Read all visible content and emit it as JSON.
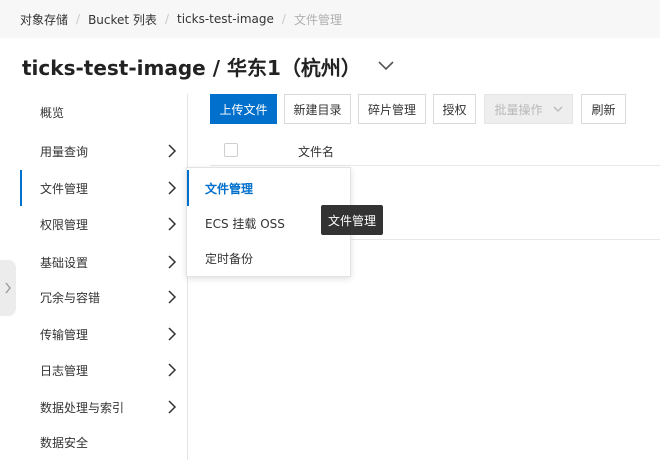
{
  "breadcrumb": {
    "items": [
      "对象存储",
      "Bucket 列表",
      "ticks-test-image",
      "文件管理"
    ],
    "separator": "/"
  },
  "header": {
    "title": "ticks-test-image / 华东1（杭州）",
    "dropdown_icon": "chevron-down-icon"
  },
  "sidebar": {
    "items": [
      {
        "label": "概览",
        "has_arrow": false
      },
      {
        "label": "用量查询",
        "has_arrow": true
      },
      {
        "label": "文件管理",
        "has_arrow": true,
        "active": true
      },
      {
        "label": "权限管理",
        "has_arrow": true
      },
      {
        "label": "基础设置",
        "has_arrow": true
      },
      {
        "label": "冗余与容错",
        "has_arrow": true
      },
      {
        "label": "传输管理",
        "has_arrow": true
      },
      {
        "label": "日志管理",
        "has_arrow": true
      },
      {
        "label": "数据处理与索引",
        "has_arrow": true
      },
      {
        "label": "数据安全",
        "has_arrow": false
      }
    ]
  },
  "toolbar": {
    "upload_label": "上传文件",
    "new_dir_label": "新建目录",
    "fragments_label": "碎片管理",
    "authorize_label": "授权",
    "batch_label": "批量操作",
    "refresh_label": "刷新"
  },
  "table": {
    "columns": [
      "文件名"
    ]
  },
  "submenu": {
    "items": [
      {
        "label": "文件管理",
        "active": true
      },
      {
        "label": "ECS 挂载 OSS"
      },
      {
        "label": "定时备份"
      }
    ]
  },
  "tooltip": {
    "text": "文件管理"
  },
  "colors": {
    "accent": "#0070cc",
    "tooltip_bg": "#333333",
    "breadcrumb_bg": "#f7f7f7"
  }
}
